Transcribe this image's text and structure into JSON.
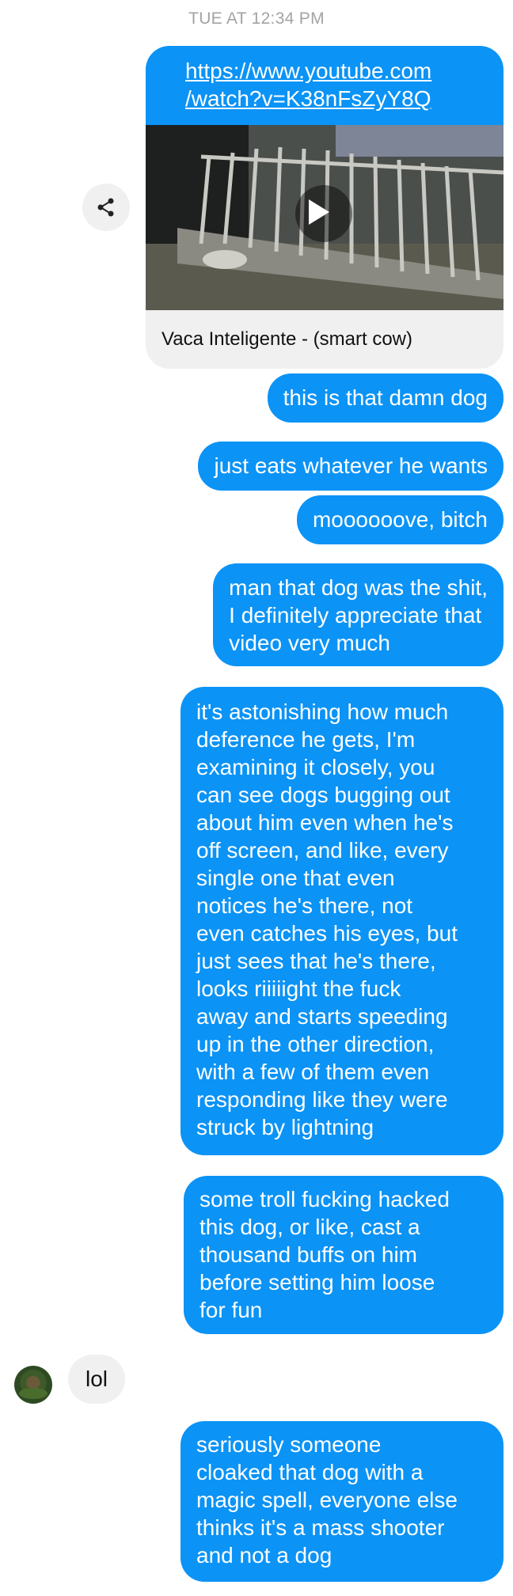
{
  "thread": {
    "timestamp": "TUE AT 12:34 PM",
    "link_card": {
      "url": "https://www.youtube.com\n/watch?v=K38nFsZyY8Q",
      "title": "Vaca Inteligente - (smart cow)",
      "share_icon": "share-icon",
      "play_icon": "play-icon"
    },
    "messages": [
      {
        "text": "this is that damn dog"
      },
      {
        "text": "just eats whatever he wants"
      },
      {
        "text": "moooooove, bitch"
      },
      {
        "text": "man that dog was the shit,\nI definitely appreciate that\nvideo very much"
      },
      {
        "text": "it's astonishing how much\ndeference he gets, I'm\nexamining it closely, you\ncan see dogs bugging out\nabout him even when he's\noff screen, and like, every\nsingle one that even\nnotices he's there, not\neven catches his eyes, but\njust sees that he's there,\nlooks riiiiight the fuck\naway and starts speeding\nup in the other direction,\nwith a few of them even\nresponding like they were\nstruck by lightning"
      },
      {
        "text": "some troll fucking hacked\nthis dog, or like, cast a\nthousand buffs on him\nbefore setting him loose\nfor fun"
      },
      {
        "text": "seriously someone\ncloaked that dog with a\nmagic spell, everyone else\nthinks it's a mass shooter\nand not a dog"
      }
    ],
    "incoming": {
      "text": "lol"
    }
  },
  "colors": {
    "outgoing_bubble": "#0b93f6",
    "incoming_bubble": "#f1f0f0",
    "timestamp": "#a3a3a3"
  }
}
